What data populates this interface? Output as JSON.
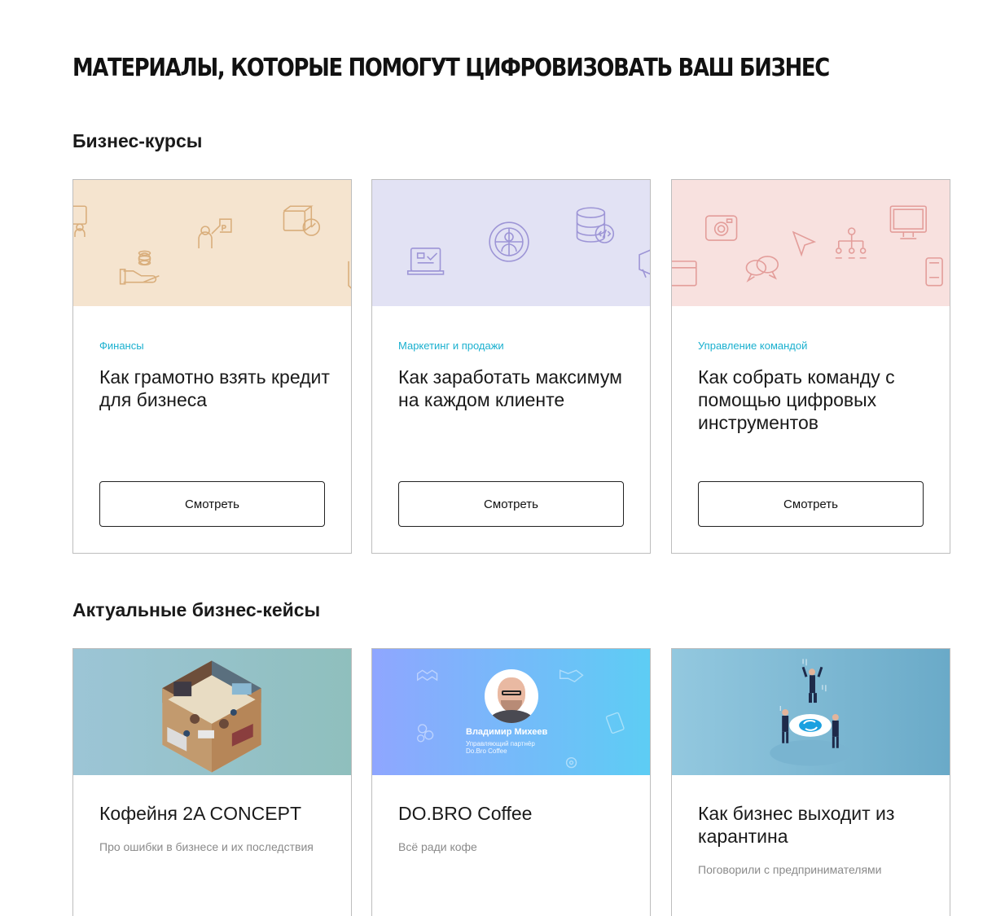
{
  "page": {
    "title": "МАТЕРИАЛЫ, КОТОРЫЕ ПОМОГУТ ЦИФРОВИЗОВАТЬ ВАШ БИЗНЕС"
  },
  "courses": {
    "heading": "Бизнес-курсы",
    "items": [
      {
        "category": "Финансы",
        "title": "Как грамотно взять кредит для бизнеса",
        "button": "Смотреть",
        "bg": "#f5e4cf",
        "stroke": "#d9ae7c"
      },
      {
        "category": "Маркетинг и продажи",
        "title": "Как заработать максимум на каждом клиенте",
        "button": "Смотреть",
        "bg": "#e2e2f4",
        "stroke": "#9d95d6"
      },
      {
        "category": "Управление командой",
        "title": "Как собрать команду с помощью цифровых инструментов",
        "button": "Смотреть",
        "bg": "#f8e1df",
        "stroke": "#e39d9a"
      }
    ]
  },
  "cases": {
    "heading": "Актуальные бизнес-кейсы",
    "items": [
      {
        "title": "Кофейня 2A CONCEPT",
        "subtitle": "Про ошибки в бизнесе и их последствия"
      },
      {
        "title": "DO.BRO Coffee",
        "subtitle": "Всё ради кофе",
        "person_name": "Владимир Михеев",
        "person_role": "Управляющий партнёр",
        "person_company": "Do.Bro Coffee"
      },
      {
        "title": "Как бизнес выходит из карантина",
        "subtitle": "Поговорили с предпринимателями"
      }
    ]
  },
  "colors": {
    "accent": "#1ab0cf",
    "border": "#bdbdbd"
  }
}
